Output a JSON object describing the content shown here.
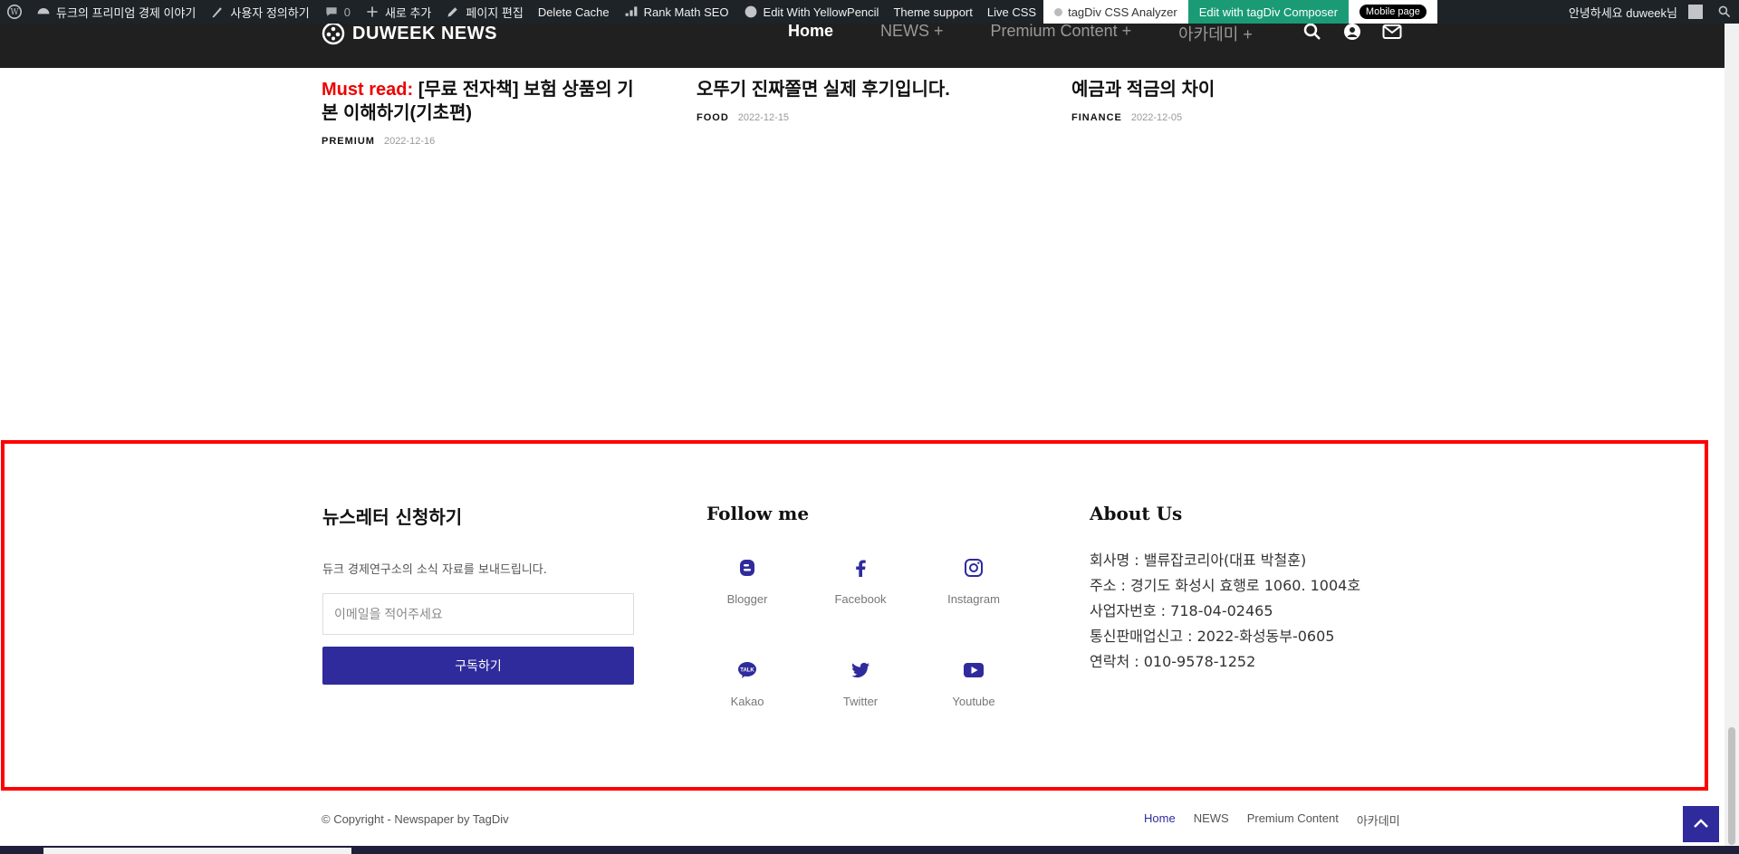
{
  "admin_bar": {
    "site_name": "듀크의 프리미엄 경제 이야기",
    "customize": "사용자 정의하기",
    "comments_count": "0",
    "new": "새로 추가",
    "edit_page": "페이지 편집",
    "delete_cache": "Delete Cache",
    "rank_math": "Rank Math SEO",
    "yellow_pencil": "Edit With YellowPencil",
    "theme_support": "Theme support",
    "live_css": "Live CSS",
    "css_analyzer": "tagDiv CSS Analyzer",
    "composer": "Edit with tagDiv Composer",
    "mobile_page": "Mobile page",
    "greeting": "안녕하세요 duweek님"
  },
  "header": {
    "logo_text": "DUWEEK NEWS",
    "nav": [
      "Home",
      "NEWS  +",
      "Premium Content  +",
      "아카데미  +"
    ]
  },
  "articles": [
    {
      "prefix": "Must read:",
      "title": "[무료 전자책] 보험 상품의 기본 이해하기(기초편)",
      "category": "PREMIUM",
      "date": "2022-12-16"
    },
    {
      "prefix": "",
      "title": "오뚜기 진짜쫄면 실제 후기입니다.",
      "category": "FOOD",
      "date": "2022-12-15"
    },
    {
      "prefix": "",
      "title": "예금과 적금의 차이",
      "category": "FINANCE",
      "date": "2022-12-05"
    }
  ],
  "newsletter": {
    "heading": "뉴스레터 신청하기",
    "description": "듀크 경제연구소의 소식 자료를 보내드립니다.",
    "email_placeholder": "이메일을 적어주세요",
    "subscribe": "구독하기"
  },
  "follow": {
    "heading": "Follow me",
    "items": [
      {
        "label": "Blogger",
        "icon": "blogger-icon"
      },
      {
        "label": "Facebook",
        "icon": "facebook-icon"
      },
      {
        "label": "Instagram",
        "icon": "instagram-icon"
      },
      {
        "label": "Kakao",
        "icon": "kakao-icon"
      },
      {
        "label": "Twitter",
        "icon": "twitter-icon"
      },
      {
        "label": "Youtube",
        "icon": "youtube-icon"
      }
    ]
  },
  "about": {
    "heading": "About Us",
    "lines": [
      "회사명 : 밸류잡코리아(대표 박철훈)",
      "주소 : 경기도 화성시 효행로 1060. 1004호",
      "사업자번호 : 718-04-02465",
      "통신판매업신고 : 2022-화성동부-0605",
      "연락처 : 010-9578-1252"
    ]
  },
  "footer": {
    "copyright": "© Copyright - Newspaper by TagDiv",
    "nav": [
      "Home",
      "NEWS",
      "Premium Content",
      "아카데미"
    ]
  },
  "colors": {
    "accent": "#2f2b9c",
    "highlight_border": "#ff0000",
    "must_read": "#ee0000"
  }
}
